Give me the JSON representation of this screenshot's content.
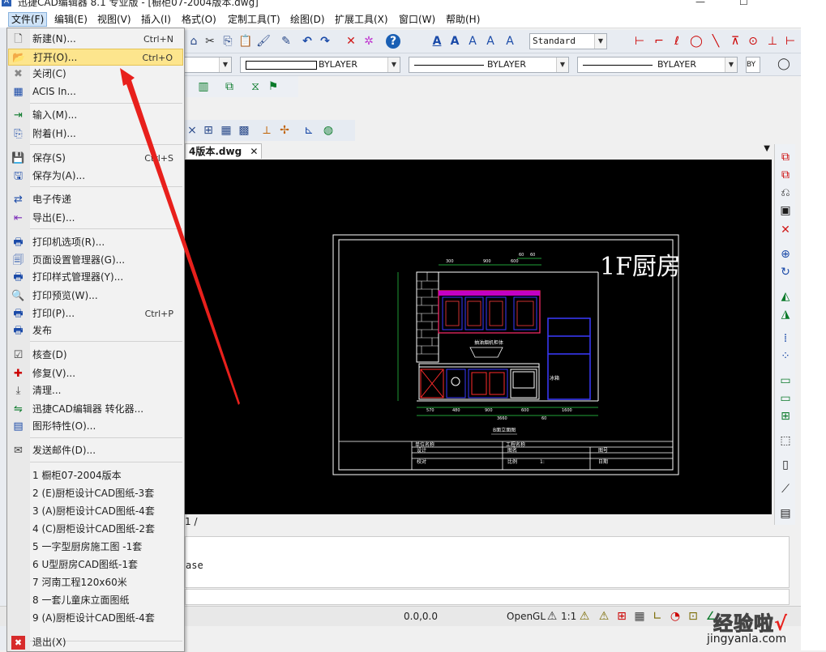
{
  "window": {
    "title": "迅捷CAD编辑器 8.1 专业版 - [橱柜07-2004版本.dwg]",
    "min_label": "—",
    "max_label": "☐"
  },
  "menubar": [
    {
      "label": "文件(F)"
    },
    {
      "label": "编辑(E)"
    },
    {
      "label": "视图(V)"
    },
    {
      "label": "插入(I)"
    },
    {
      "label": "格式(O)"
    },
    {
      "label": "定制工具(T)"
    },
    {
      "label": "绘图(D)"
    },
    {
      "label": "扩展工具(X)"
    },
    {
      "label": "窗口(W)"
    },
    {
      "label": "帮助(H)"
    }
  ],
  "toolbar": {
    "text_style_value": "Standard",
    "linetype_values": [
      "BYLAYER",
      "BYLAYER",
      "BYLAYER"
    ],
    "bylayer_short": "BY"
  },
  "file_menu": {
    "items": [
      {
        "label": "新建(N)...",
        "shortcut": "Ctrl+N",
        "icon": "new-file-icon",
        "glyph": "🗋"
      },
      {
        "label": "打开(O)...",
        "shortcut": "Ctrl+O",
        "icon": "open-folder-icon",
        "glyph": "📂",
        "highlight": true
      },
      {
        "label": "关闭(C)",
        "shortcut": "",
        "icon": "close-icon",
        "glyph": "✖"
      },
      {
        "label": "ACIS In...",
        "shortcut": "",
        "icon": "acis-import-icon",
        "glyph": "▦"
      },
      {
        "label": "输入(M)...",
        "shortcut": "",
        "icon": "import-icon",
        "glyph": "⇥"
      },
      {
        "label": "附着(H)...",
        "shortcut": "",
        "icon": "attach-icon",
        "glyph": "⎘"
      },
      {
        "label": "保存(S)",
        "shortcut": "Ctrl+S",
        "icon": "save-icon",
        "glyph": "💾"
      },
      {
        "label": "保存为(A)...",
        "shortcut": "",
        "icon": "save-as-icon",
        "glyph": "🖫"
      },
      {
        "label": "电子传递",
        "shortcut": "",
        "icon": "etransmit-icon",
        "glyph": "⇄"
      },
      {
        "label": "导出(E)...",
        "shortcut": "",
        "icon": "export-icon",
        "glyph": "⇤"
      },
      {
        "label": "打印机选项(R)...",
        "shortcut": "",
        "icon": "printer-options-icon",
        "glyph": "🖶"
      },
      {
        "label": "页面设置管理器(G)...",
        "shortcut": "",
        "icon": "page-setup-icon",
        "glyph": "🗐"
      },
      {
        "label": "打印样式管理器(Y)...",
        "shortcut": "",
        "icon": "plot-style-icon",
        "glyph": "🖶"
      },
      {
        "label": "打印预览(W)...",
        "shortcut": "",
        "icon": "print-preview-icon",
        "glyph": "🔍"
      },
      {
        "label": "打印(P)...",
        "shortcut": "Ctrl+P",
        "icon": "print-icon",
        "glyph": "🖶"
      },
      {
        "label": "发布",
        "shortcut": "",
        "icon": "publish-icon",
        "glyph": "🖶"
      },
      {
        "label": "核查(D)",
        "shortcut": "",
        "icon": "audit-icon",
        "glyph": "☑"
      },
      {
        "label": "修复(V)...",
        "shortcut": "",
        "icon": "recover-icon",
        "glyph": "✚"
      },
      {
        "label": "清理...",
        "shortcut": "",
        "icon": "purge-icon",
        "glyph": "⤓"
      },
      {
        "label": "迅捷CAD编辑器 转化器...",
        "shortcut": "",
        "icon": "converter-icon",
        "glyph": "⇋"
      },
      {
        "label": "图形特性(O)...",
        "shortcut": "",
        "icon": "drawing-properties-icon",
        "glyph": "▤"
      },
      {
        "label": "发送邮件(D)...",
        "shortcut": "",
        "icon": "send-mail-icon",
        "glyph": "✉"
      }
    ],
    "recent": [
      "1 橱柜07-2004版本",
      "2 (E)厨柜设计CAD图纸-3套",
      "3 (A)厨柜设计CAD图纸-4套",
      "4 (C)厨柜设计CAD图纸-2套",
      "5 一字型厨房施工图 -1套",
      "6 U型厨房CAD图纸-1套",
      "7 河南工程120x60米",
      "8 一套儿童床立面图纸",
      "9 (A)厨柜设计CAD图纸-4套"
    ],
    "exit": {
      "label": "退出(X)",
      "icon": "exit-icon",
      "glyph": "✖"
    }
  },
  "drawing_tab": {
    "label": "4版本.dwg",
    "close": "✕"
  },
  "drawing": {
    "title_text": "1F厨房",
    "elevation_caption": "B面立面图",
    "dims_top": [
      "300",
      "900",
      "600",
      "60",
      "60"
    ],
    "dims_bottom_1": [
      "570",
      "480",
      "900",
      "600",
      "1600"
    ],
    "dims_bottom_2": [
      "3660",
      "60"
    ],
    "label_hood": "抽油烟机柜体",
    "label_fridge": "冰箱",
    "title_block": {
      "r1": [
        "单位名称",
        "工程名称"
      ],
      "r2": [
        "设计",
        "图名",
        "图号"
      ],
      "r3": [
        "校对",
        "比例",
        "1:",
        "日期"
      ]
    }
  },
  "layout_tab": "1 /",
  "command_text": "ase",
  "status": {
    "coords": "0.0,0.0",
    "render": "OpenGL",
    "scale": "1:1"
  },
  "watermark": {
    "text": "经验啦",
    "check": "√",
    "url": "jingyanla.com"
  },
  "colors": {
    "highlight": "#fde58d",
    "arrow": "#e8201c",
    "canvas": "#000000"
  }
}
